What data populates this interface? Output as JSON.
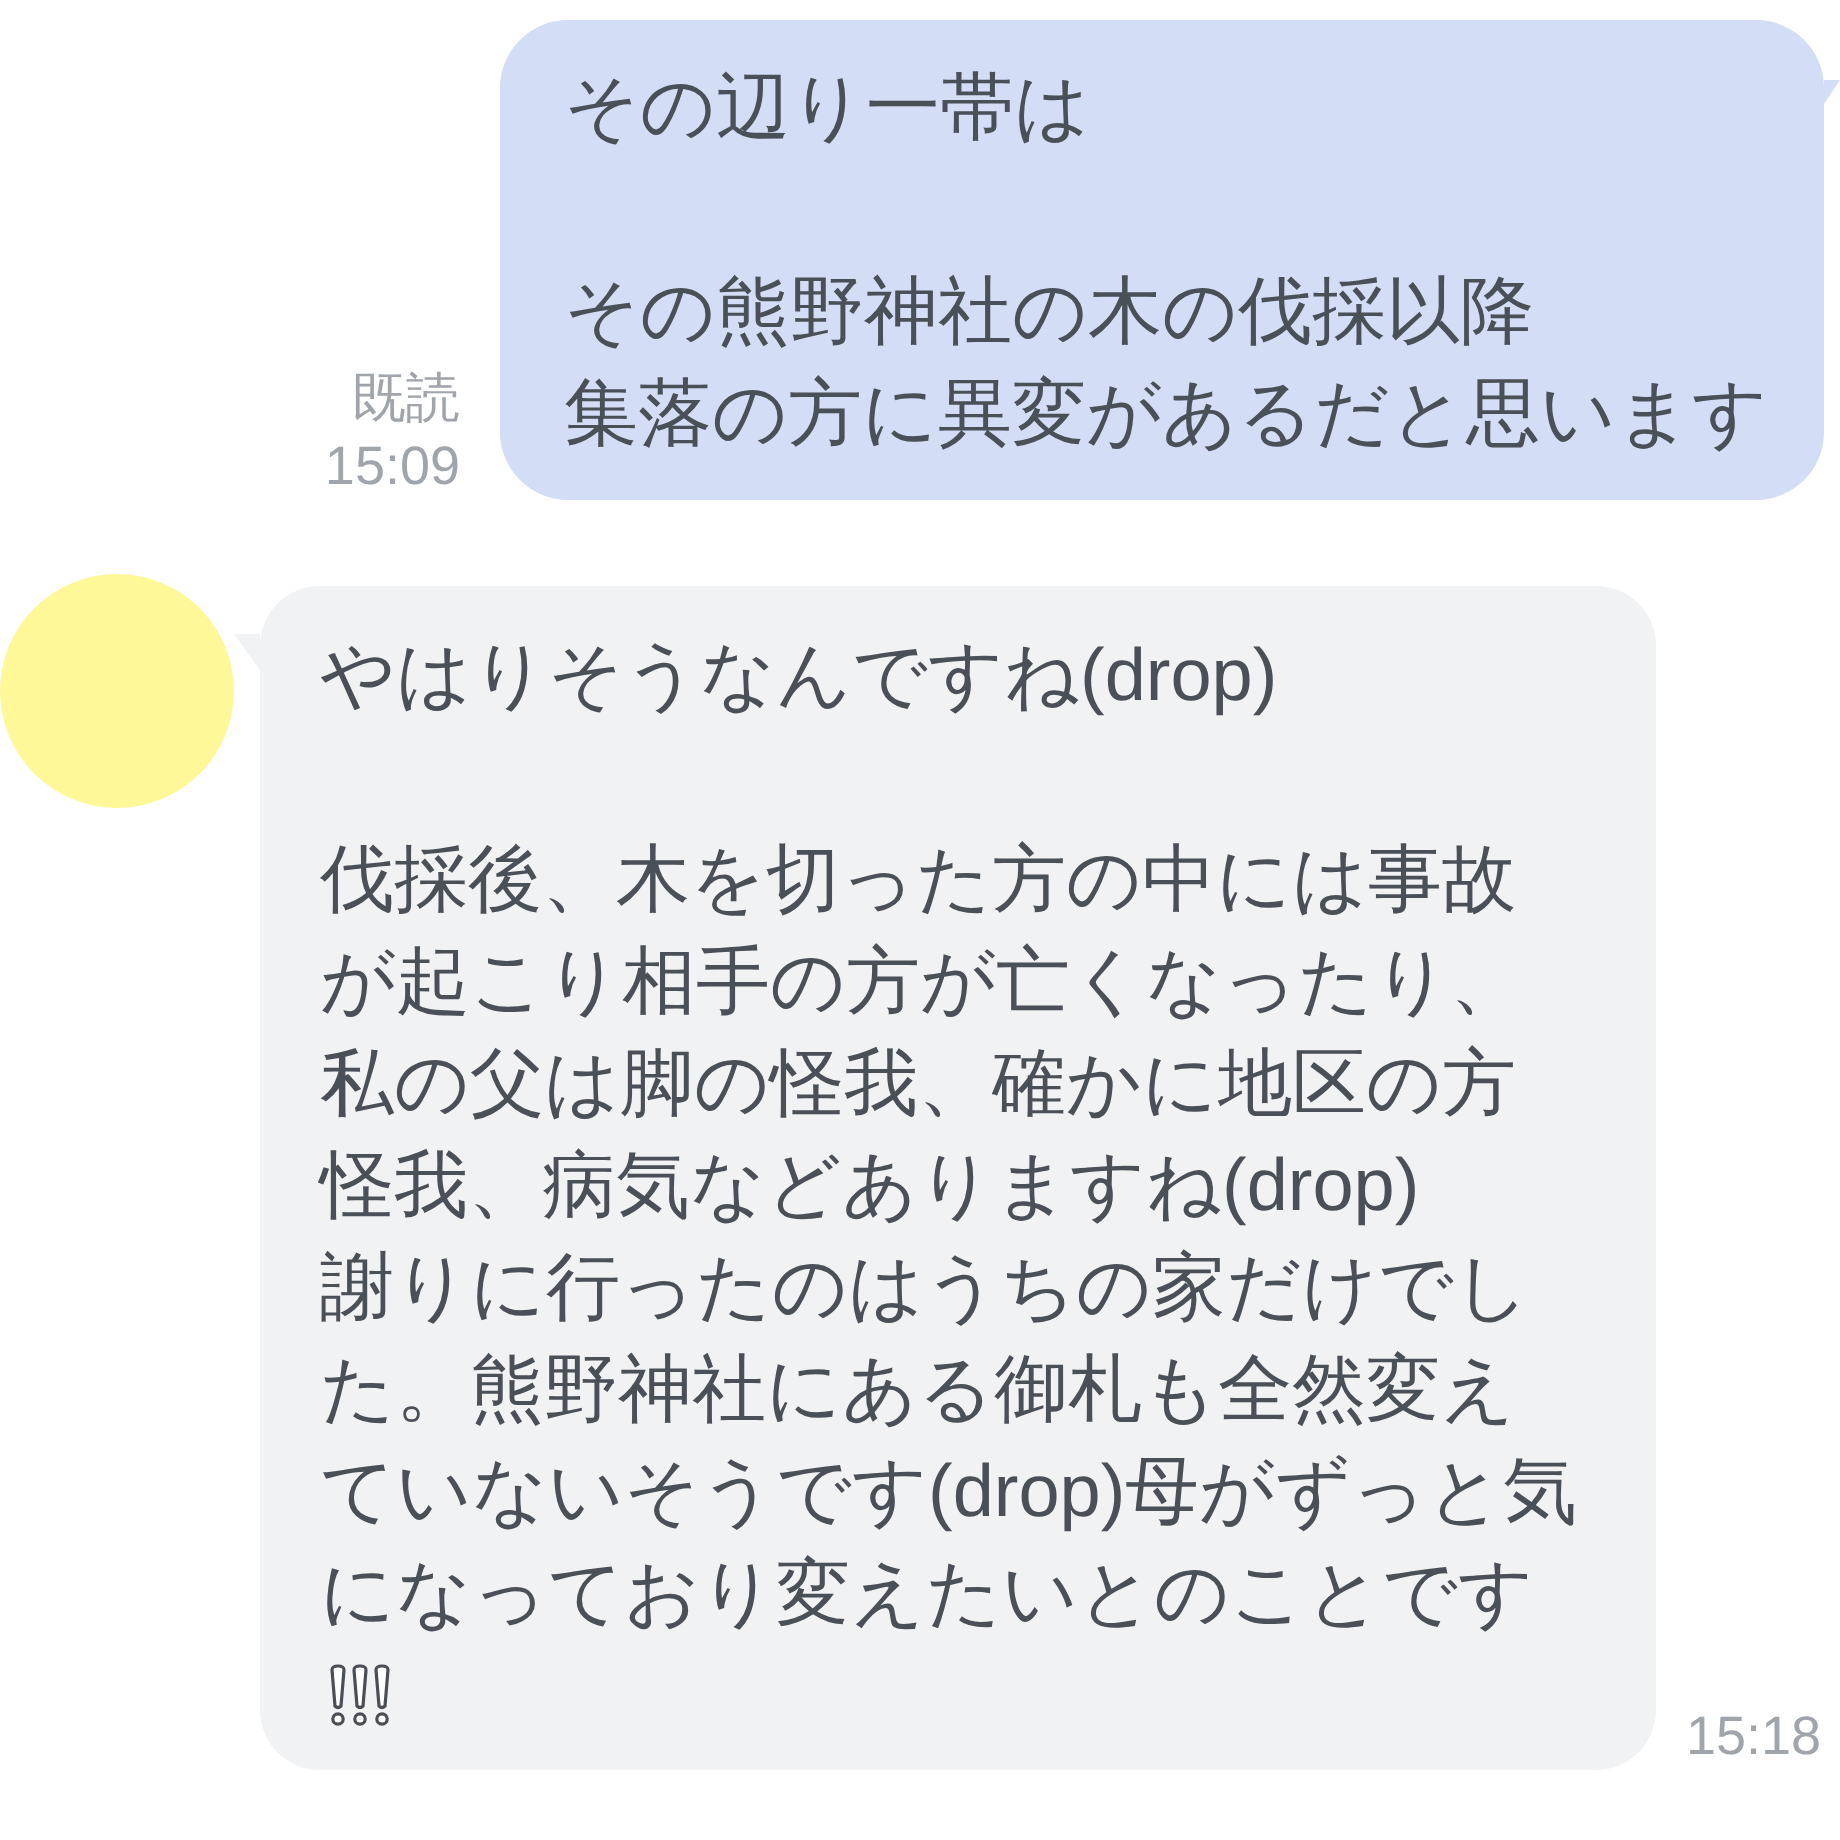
{
  "messages": [
    {
      "kind": "sent",
      "read_label": "既読",
      "time": "15:09",
      "content": [
        {
          "kind": "text",
          "text": "その辺り一帯は"
        },
        {
          "kind": "blank"
        },
        {
          "kind": "text",
          "text": "その熊野神社の木の伐採以降"
        },
        {
          "kind": "text",
          "text": "集落の方に異変があるだと思います"
        }
      ]
    },
    {
      "kind": "received",
      "time": "15:18",
      "content": [
        {
          "kind": "text",
          "text": "やはりそうなんですね(drop)"
        },
        {
          "kind": "blank"
        },
        {
          "kind": "text",
          "text": "伐採後、木を切った方の中には事故が起こり相手の方が亡くなったり、私の父は脚の怪我、確かに地区の方怪我、病気などありますね(drop)"
        },
        {
          "kind": "text",
          "text": "謝りに行ったのはうちの家だけでした。熊野神社にある御札も全然変えていないそうです(drop)母がずっと気になっており変えたいとのことです"
        },
        {
          "kind": "emoji"
        }
      ]
    }
  ]
}
